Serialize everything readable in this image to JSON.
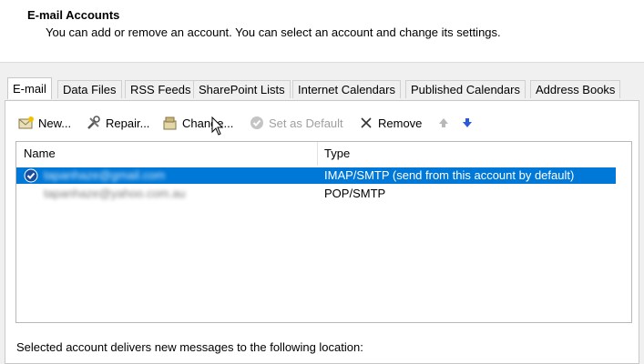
{
  "header": {
    "title": "E-mail Accounts",
    "subtitle": "You can add or remove an account. You can select an account and change its settings."
  },
  "tabs": [
    {
      "label": "E-mail",
      "active": true
    },
    {
      "label": "Data Files"
    },
    {
      "label": "RSS Feeds"
    },
    {
      "label": "SharePoint Lists"
    },
    {
      "label": "Internet Calendars"
    },
    {
      "label": "Published Calendars"
    },
    {
      "label": "Address Books"
    }
  ],
  "toolbar": {
    "new_label": "New...",
    "repair_label": "Repair...",
    "change_label": "Change...",
    "set_default_label": "Set as Default",
    "remove_label": "Remove"
  },
  "accounts_table": {
    "columns": [
      "Name",
      "Type"
    ],
    "rows": [
      {
        "name": "tapanhaze@gmail.com",
        "type": "IMAP/SMTP (send from this account by default)",
        "selected": true,
        "default": true
      },
      {
        "name": "tapanhaze@yahoo.com.au",
        "type": "POP/SMTP",
        "selected": false
      }
    ]
  },
  "footer": {
    "delivery_text": "Selected account delivers new messages to the following location:"
  },
  "colors": {
    "selection": "#0078d7",
    "arrow_icon": "#2b5ad6"
  }
}
